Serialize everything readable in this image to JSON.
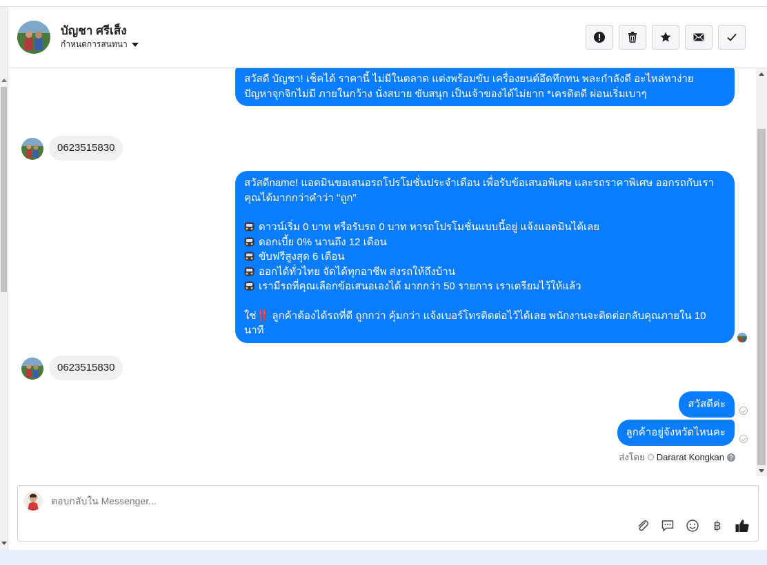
{
  "header": {
    "name": "บัญชา ศรีเส็ง",
    "subtitle": "กำหนดการสนทนา",
    "actions": [
      "alert-icon",
      "trash-icon",
      "star-icon",
      "mail-icon",
      "check-icon"
    ]
  },
  "messages": {
    "m1_line1": "สวัสดี บัญชา! เช็คได้ ราคานี้ ไม่มีในตลาด แต่งพร้อมขับ เครื่องยนต์อึดทึกทน พละกำลังดี อะไหล่หาง่าย",
    "m1_line2": "ปัญหาจุกจิกไม่มี ภายในกว้าง นั่งสบาย ขับสนุก เป็นเจ้าของได้ไม่ยาก *เครดิตดี ผ่อนเริ่มเบาๆ",
    "in1": "0623515830",
    "promo_intro": "สวัสดีname! แอดมินขอเสนอรถโปรโมชั่นประจำเดือน เพื่อรับข้อเสนอพิเศษ และรถราคาพิเศษ ออกรถกับเรา คุณได้มากกว่าคำว่า \"ถูก\"",
    "promo_points": [
      "ดาวน์เริ่ม 0 บาท หรือรับรถ 0 บาท หารถโปรโมชั่นแบบนี้อยู่ แจ้งแอดมินได้เลย",
      "ดอกเบี้ย 0% นานถึง 12 เดือน",
      "ขับฟรีสูงสุด 6 เดือน",
      "ออกได้ทั่วไทย จัดได้ทุกอาชีพ ส่งรถให้ถึงบ้าน",
      "เรามีรถที่คุณเลือกข้อเสนอเองได้ มากกว่า 50 รายการ เราเตรียมไว้ให้แล้ว"
    ],
    "promo_outro_a": "ใช่",
    "promo_outro_bang": "‼️",
    "promo_outro_b": " ลูกค้าต้องได้รถที่ดี ถูกกว่า คุ้มกว่า แจ้งเบอร์โทรติดต่อไว้ได้เลย พนักงานจะติดต่อกลับคุณภายใน 10 นาที",
    "in2": "0623515830",
    "out_hello": "สวัสดีค่ะ",
    "out_question": "ลูกค้าอยู่จังหวัดไหนคะ"
  },
  "sent_by": {
    "label": "ส่งโดย",
    "agent": "Dararat Kongkan"
  },
  "composer": {
    "placeholder": "ตอบกลับใน Messenger...",
    "tools": [
      "paperclip-icon",
      "saved-reply-icon",
      "emoji-icon",
      "baht-icon",
      "thumbs-up-icon"
    ],
    "baht_symbol": "฿"
  },
  "colors": {
    "outgoing_bubble": "#0a7cff",
    "incoming_bubble": "#f0f0f0"
  }
}
